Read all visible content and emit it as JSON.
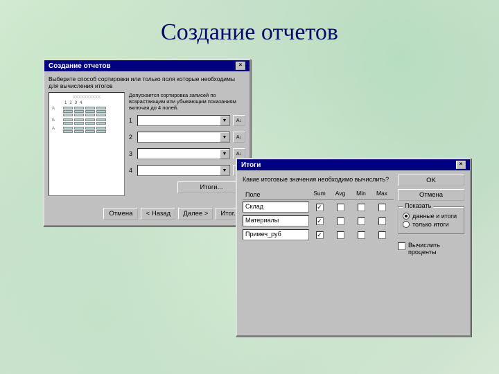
{
  "slide_title": "Создание отчетов",
  "win1": {
    "title": "Создание отчетов",
    "instruction": "Выберите способ сортировки или только поля которые необходимы для вычисления итогов",
    "sub_instruction": "Допускается сортировка записей по возрастающим или убывающим показаниям включая до 4 полей.",
    "sort_nums": [
      "1",
      "2",
      "3",
      "4"
    ],
    "preview_cols": [
      "1",
      "2",
      "3",
      "4"
    ],
    "group_a": "А",
    "group_b": "Б",
    "itogi_btn": "Итоги...",
    "buttons": {
      "cancel": "Отмена",
      "back": "< Назад",
      "next": "Далее >",
      "finish": "Итог..."
    }
  },
  "win2": {
    "title": "Итоги",
    "question": "Какие итоговые значения необходимо вычислить?",
    "ok": "OK",
    "cancel": "Отмена",
    "table": {
      "head_field": "Поле",
      "cols": [
        "Sum",
        "Avg",
        "Min",
        "Max"
      ],
      "rows": [
        {
          "name": "Склад",
          "checks": [
            true,
            false,
            false,
            false
          ]
        },
        {
          "name": "Материалы",
          "checks": [
            true,
            false,
            false,
            false
          ]
        },
        {
          "name": "Примеч_руб",
          "checks": [
            true,
            false,
            false,
            false
          ]
        }
      ]
    },
    "show_group": {
      "legend": "Показать",
      "opt1": "данные и итоги",
      "opt2": "только итоги",
      "selected": 0
    },
    "percent_check": {
      "checked": false,
      "label": "Вычислить проценты"
    }
  }
}
